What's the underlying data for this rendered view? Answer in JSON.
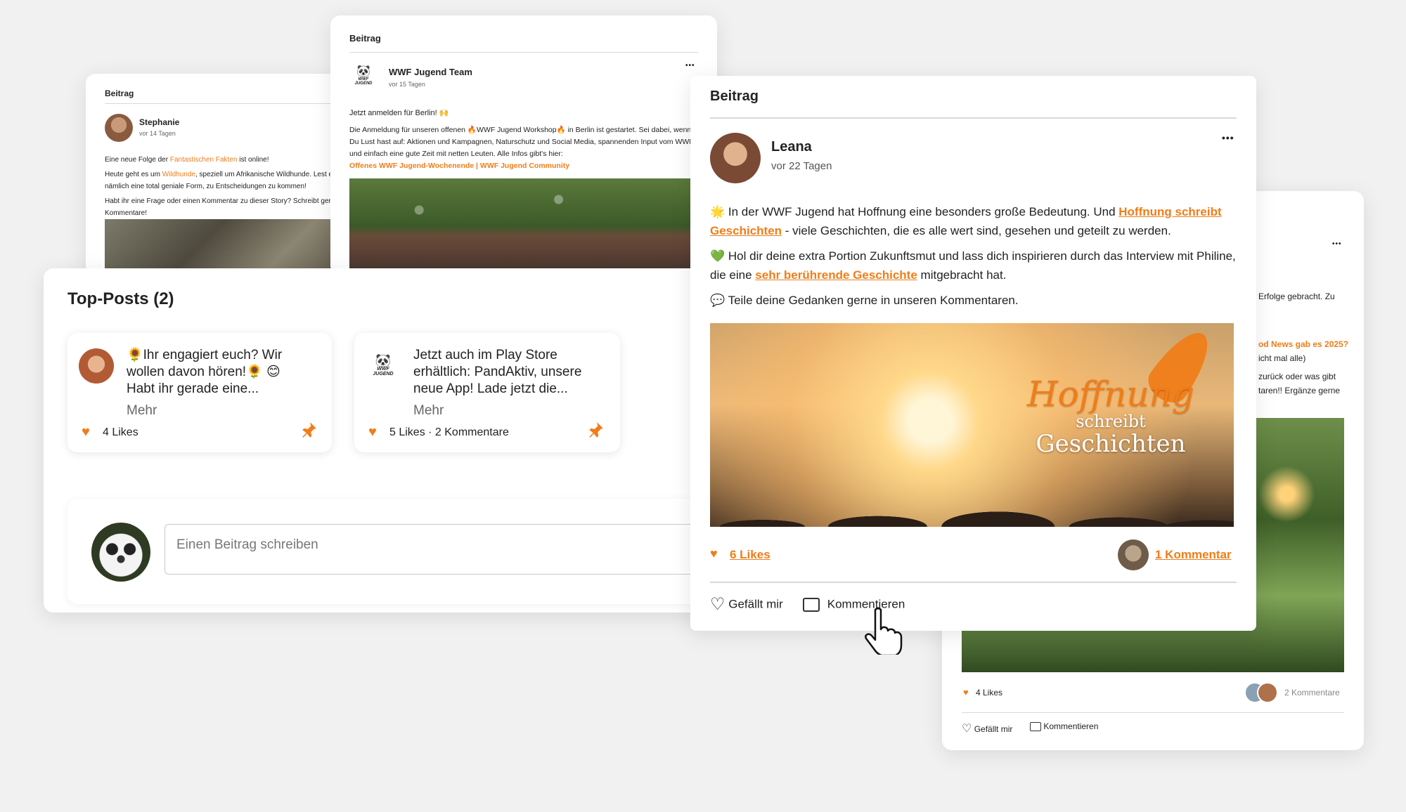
{
  "back_card_left": {
    "section": "Beitrag",
    "author": "Stephanie",
    "time": "vor 14 Tagen",
    "line1_pre": "Eine neue Folge der ",
    "line1_link": "Fantastischen Fakten",
    "line1_post": " ist online!",
    "line2_pre": "Heute geht es um ",
    "line2_link": "Wildhunde",
    "line2_post": ", speziell um Afrikanische Wildhunde. Lest e",
    "line3": "nämlich eine total geniale Form, zu Entscheidungen zu kommen!",
    "line4": "Habt ihr eine Frage oder einen Kommentar zu dieser Story? Schreibt gern",
    "line5": "Kommentare!"
  },
  "back_card_middle": {
    "section": "Beitrag",
    "author": "WWF Jugend Team",
    "time": "vor 15 Tagen",
    "logo_text": "WWF JUGEND",
    "headline": "Jetzt anmelden für Berlin! 🙌",
    "body": "Die Anmeldung für unseren offenen 🔥WWF Jugend Workshop🔥 in Berlin ist gestartet. Sei dabei, wenn Du Lust hast auf: Aktionen und Kampagnen, Naturschutz und Social Media, spannenden Input vom WWF und einfach eine gute Zeit mit netten Leuten. Alle Infos gibt's hier:",
    "link": "Offenes WWF Jugend-Wochenende | WWF Jugend Community",
    "menu": "•••"
  },
  "back_card_right": {
    "menu": "•••",
    "text1": "Erfolge gebracht. Zu",
    "text2": "od News gab es 2025?",
    "text3": "icht mal alle)",
    "text4": "zurück oder was gibt",
    "text5": "taren!! Ergänze gerne",
    "likes": "4 Likes",
    "comments": "2 Kommentare",
    "like_btn": "Gefällt mir",
    "comment_btn": "Kommentieren"
  },
  "top_posts": {
    "title": "Top-Posts (2)",
    "posts": [
      {
        "text": "🌻Ihr engagiert euch? Wir wollen davon hören!🌻 😊 Habt ihr gerade eine...",
        "more": "Mehr",
        "stats": "4 Likes"
      },
      {
        "text": "Jetzt auch im Play Store erhältlich: PandAktiv, unsere neue App! Lade jetzt die...",
        "more": "Mehr",
        "stats": "5 Likes · 2 Kommentare",
        "logo_text": "WWF JUGEND"
      }
    ],
    "composer_placeholder": "Einen Beitrag schreiben"
  },
  "main_post": {
    "section": "Beitrag",
    "author": "Leana",
    "time": "vor 22 Tagen",
    "menu": "•••",
    "p1_pre": "🌟 In der WWF Jugend hat Hoffnung eine besonders große Bedeutung. Und ",
    "p1_link": "Hoffnung schreibt Geschichten",
    "p1_post": " - viele Geschichten, die es alle wert sind, gesehen und geteilt zu werden.",
    "p2_pre": "💚 Hol dir deine extra Portion Zukunftsmut und lass dich inspirieren durch das Interview mit Philine, die eine ",
    "p2_link": "sehr berührende Geschichte",
    "p2_post": " mitgebracht hat.",
    "p3": "💬 Teile deine Gedanken gerne in unseren Kommentaren.",
    "image_title_1": "Hoffnung",
    "image_title_2": "schreibt",
    "image_title_3": "Geschichten",
    "likes": "6 Likes",
    "comments": "1 Kommentar",
    "like_btn": "Gefällt mir",
    "comment_btn": "Kommentieren"
  },
  "colors": {
    "accent": "#f07d19",
    "background": "#f1f1f1"
  }
}
